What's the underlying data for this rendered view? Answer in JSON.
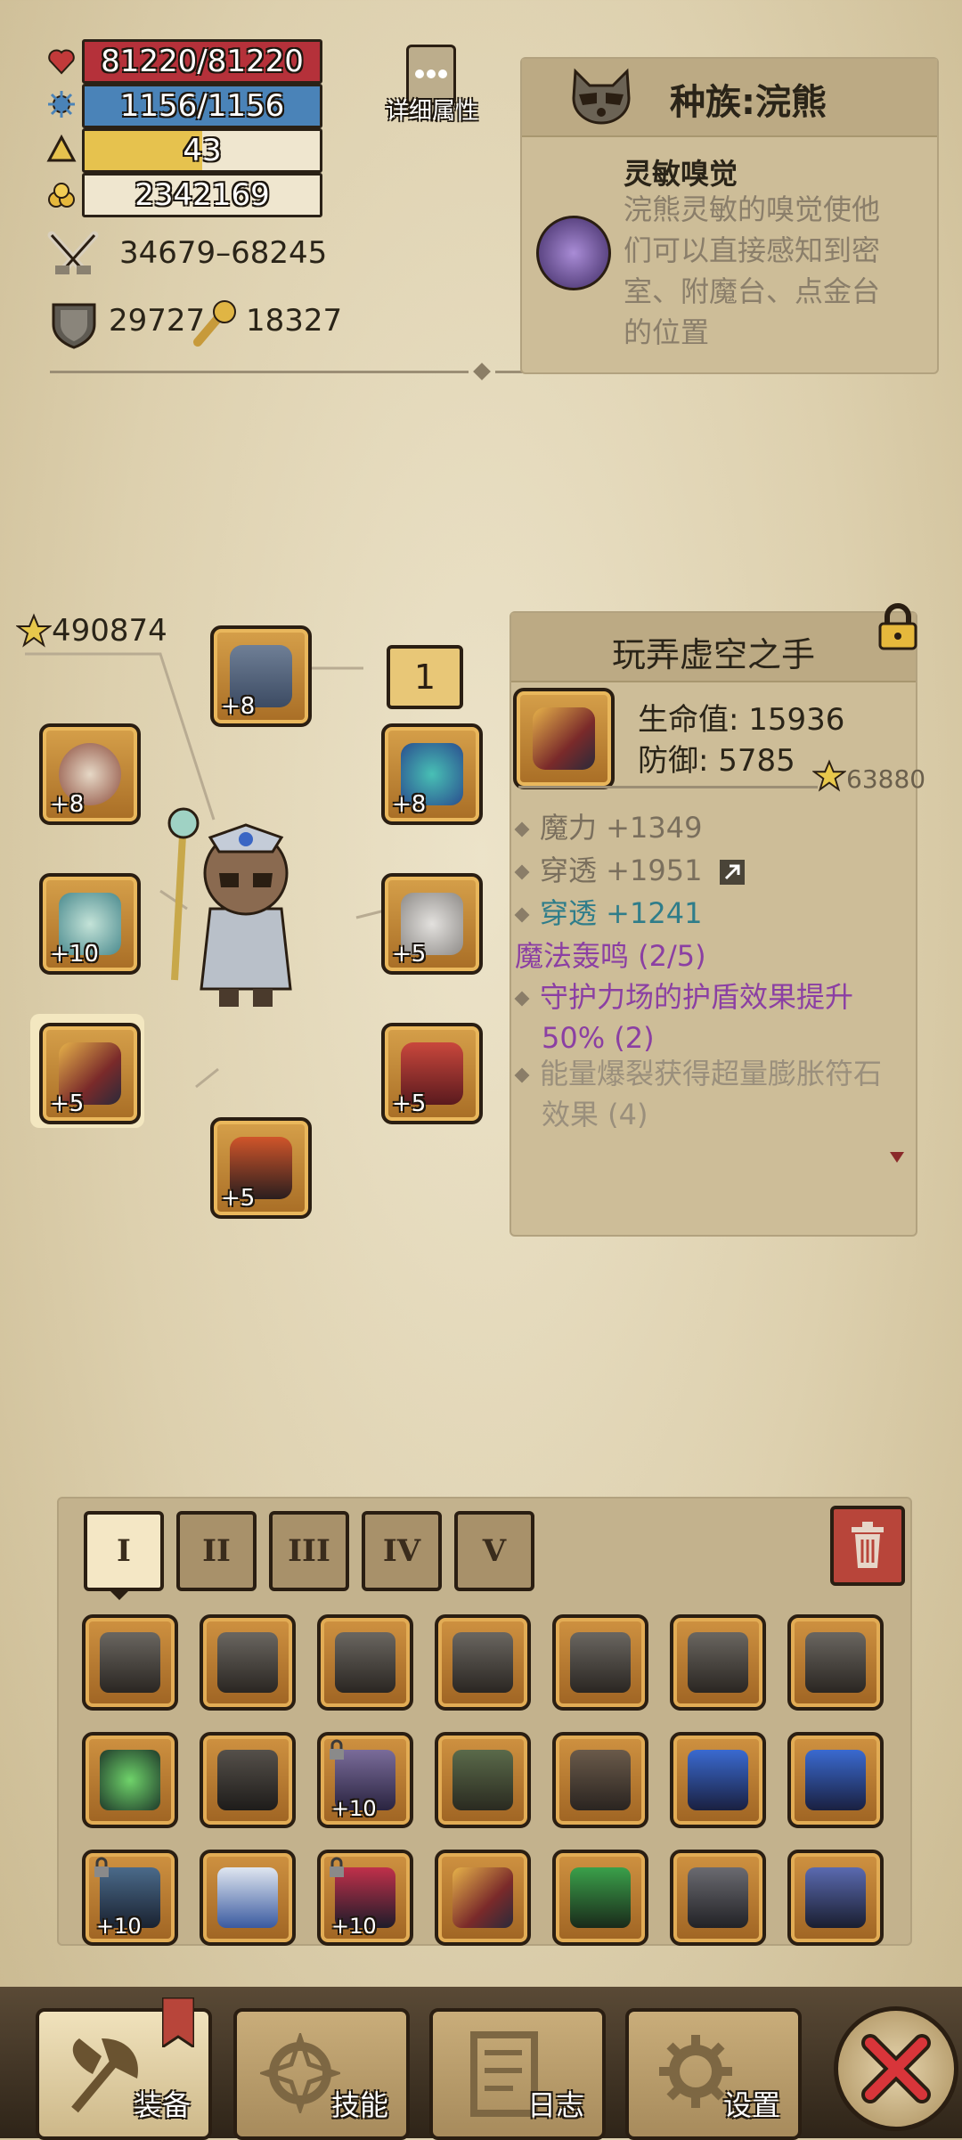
{
  "stats": {
    "hp": "81220/81220",
    "mana": "1156/1156",
    "level": "43",
    "gold": "2342169",
    "attack": "34679–68245",
    "defense": "29727",
    "crit": "18327",
    "hp_fill": 1.0,
    "mana_fill": 1.0,
    "level_fill": 0.5
  },
  "details_label": "详细属性",
  "race": {
    "title": "种族:浣熊",
    "ability_name": "灵敏嗅觉",
    "ability_lines": [
      "浣熊灵敏的嗅觉使他",
      "们可以直接感知到密",
      "室、附魔台、点金台",
      "的位置"
    ]
  },
  "power_score": "490874",
  "loadout_badge": "1",
  "equipment": {
    "helmet": "+8",
    "weapon_offhand": "+8",
    "amulet": "+8",
    "staff": "+10",
    "wings": "+5",
    "gloves": "+5",
    "armor": "+5",
    "boots": "+5"
  },
  "item": {
    "name": "玩弄虚空之手",
    "hp_label": "生命值: 15936",
    "def_label": "防御: 5785",
    "score": "63880",
    "attr1": "魔力 +1349",
    "attr2": "穿透 +1951",
    "attr3": "穿透 +1241",
    "set_name": "魔法轰鸣 (2/5)",
    "set_bonus1_line1": "守护力场的护盾效果提升",
    "set_bonus1_line2": "50% (2)",
    "set_bonus2_line1": "能量爆裂获得超量膨胀符石",
    "set_bonus2_line2": "效果 (4)"
  },
  "tabs": [
    "I",
    "II",
    "III",
    "IV",
    "V"
  ],
  "inventory_levels": {
    "r2c3": "+10",
    "r3c1": "+10",
    "r3c3": "+10"
  },
  "nav": {
    "equip": "装备",
    "skills": "技能",
    "log": "日志",
    "settings": "设置"
  },
  "colors": {
    "hp": "#b5313a",
    "mana": "#4a83b8",
    "level": "#e6c24e",
    "set_name": "#8b3fa3",
    "highlight_attr": "#2f7d8a"
  }
}
